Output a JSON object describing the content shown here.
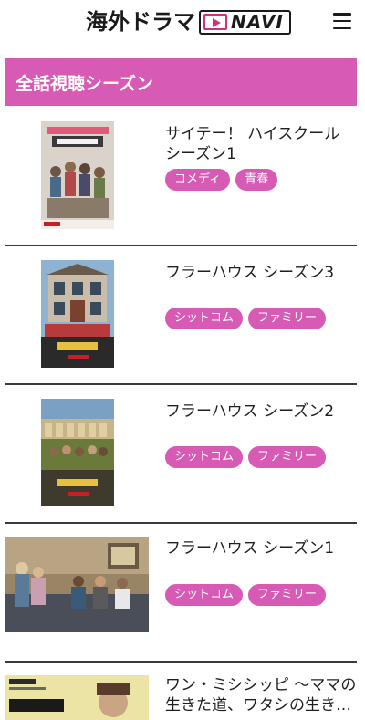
{
  "header": {
    "logo_text_jp": "海外ドラマ",
    "logo_text_en": "NAVI",
    "menu_icon": "hamburger-icon"
  },
  "section": {
    "title": "全話視聴シーズン"
  },
  "items": [
    {
      "title": "サイテー！ ハイスクール シーズン1",
      "tags": [
        "コメディ",
        "青春"
      ],
      "poster": {
        "heading": "EVERYTHING SUCKS!",
        "badge": "NETFLIX"
      }
    },
    {
      "title": "フラーハウス シーズン3",
      "tags": [
        "シットコム",
        "ファミリー"
      ],
      "poster": {
        "heading": "フラーハウス",
        "badge": "NETFLIX"
      }
    },
    {
      "title": "フラーハウス シーズン2",
      "tags": [
        "シットコム",
        "ファミリー"
      ],
      "poster": {
        "heading": "フラーハウス",
        "badge": "NETFLIX"
      }
    },
    {
      "title": "フラーハウス シーズン1",
      "tags": [
        "シットコム",
        "ファミリー"
      ]
    },
    {
      "title": "ワン・ミシシッピ 〜ママの生きた道、ワタシの生き…",
      "tags": [],
      "poster": {
        "heading": "ワン・ミシシッピ",
        "badge": "amazon"
      }
    }
  ],
  "colors": {
    "accent": "#d75ab5",
    "logo_play": "#d4307a"
  }
}
